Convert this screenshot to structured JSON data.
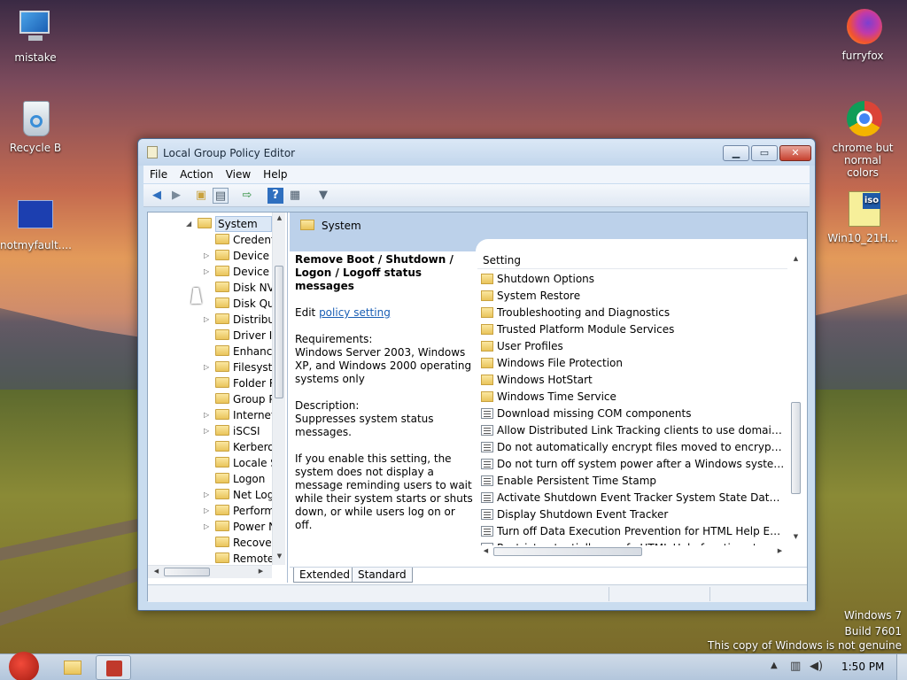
{
  "desktop": {
    "icons": [
      {
        "label": "mistake",
        "icon": "computer-icon"
      },
      {
        "label": "Recycle B",
        "icon": "recycle-bin-icon"
      },
      {
        "label": "notmyfault....",
        "icon": "bsod-icon"
      },
      {
        "label": "furryfox",
        "icon": "firefox-icon"
      },
      {
        "label": "chrome but normal colors",
        "icon": "chrome-icon"
      },
      {
        "label": "Win10_21H...",
        "icon": "iso-file-icon"
      }
    ],
    "watermark": {
      "line1": "Windows 7",
      "line2": "Build 7601",
      "line3": "This copy of Windows is not genuine"
    }
  },
  "window": {
    "title": "Local Group Policy Editor",
    "controls": {
      "minimize": "▁",
      "maximize": "▭",
      "close": "✕"
    },
    "menu": [
      "File",
      "Action",
      "View",
      "Help"
    ],
    "toolbar_icons": [
      "back-icon",
      "forward-icon",
      "up-folder-icon",
      "show-hide-tree-icon",
      "export-list-icon",
      "help-icon",
      "properties-icon",
      "filter-icon"
    ]
  },
  "tree": {
    "root": "System",
    "items": [
      {
        "label": "Credenti",
        "expandable": false
      },
      {
        "label": "Device I",
        "expandable": true
      },
      {
        "label": "Device I",
        "expandable": true
      },
      {
        "label": "Disk NV",
        "expandable": false
      },
      {
        "label": "Disk Qu",
        "expandable": false
      },
      {
        "label": "Distribu",
        "expandable": true
      },
      {
        "label": "Driver Ir",
        "expandable": false
      },
      {
        "label": "Enhanc",
        "expandable": false
      },
      {
        "label": "Filesyste",
        "expandable": true
      },
      {
        "label": "Folder R",
        "expandable": false
      },
      {
        "label": "Group P",
        "expandable": false
      },
      {
        "label": "Internet",
        "expandable": true
      },
      {
        "label": "iSCSI",
        "expandable": true
      },
      {
        "label": "Kerbero",
        "expandable": false
      },
      {
        "label": "Locale S",
        "expandable": false
      },
      {
        "label": "Logon",
        "expandable": false
      },
      {
        "label": "Net Log",
        "expandable": true
      },
      {
        "label": "Perform",
        "expandable": true
      },
      {
        "label": "Power N",
        "expandable": true
      },
      {
        "label": "Recover",
        "expandable": false
      },
      {
        "label": "Remote",
        "expandable": false
      }
    ]
  },
  "details": {
    "header": "System",
    "title": "Remove Boot / Shutdown / Logon / Logoff status messages",
    "edit_prefix": "Edit ",
    "edit_link": "policy setting",
    "requirements_label": "Requirements:",
    "requirements_text": "Windows Server 2003, Windows XP, and Windows 2000 operating systems only",
    "description_label": "Description:",
    "description_text": "Suppresses system status messages.",
    "description_more": "If you enable this setting, the system does not display a message reminding users to wait while their system starts or shuts down, or while users log on or off."
  },
  "list": {
    "column_header": "Setting",
    "rows": [
      {
        "label": "Shutdown Options",
        "type": "folder"
      },
      {
        "label": "System Restore",
        "type": "folder"
      },
      {
        "label": "Troubleshooting and Diagnostics",
        "type": "folder"
      },
      {
        "label": "Trusted Platform Module Services",
        "type": "folder"
      },
      {
        "label": "User Profiles",
        "type": "folder"
      },
      {
        "label": "Windows File Protection",
        "type": "folder"
      },
      {
        "label": "Windows HotStart",
        "type": "folder"
      },
      {
        "label": "Windows Time Service",
        "type": "folder"
      },
      {
        "label": "Download missing COM components",
        "type": "setting"
      },
      {
        "label": "Allow Distributed Link Tracking clients to use domain resour...",
        "type": "setting"
      },
      {
        "label": "Do not automatically encrypt files moved to encrypted fold...",
        "type": "setting"
      },
      {
        "label": "Do not turn off system power after a Windows system shutd...",
        "type": "setting"
      },
      {
        "label": "Enable Persistent Time Stamp",
        "type": "setting"
      },
      {
        "label": "Activate Shutdown Event Tracker System State Data feature",
        "type": "setting"
      },
      {
        "label": "Display Shutdown Event Tracker",
        "type": "setting"
      },
      {
        "label": "Turn off Data Execution Prevention for HTML Help Executible",
        "type": "setting"
      },
      {
        "label": "Restrict potentially unsafe HTML Help functions to specified...",
        "type": "setting"
      }
    ]
  },
  "tabs": [
    "Extended",
    "Standard"
  ],
  "taskbar": {
    "clock": "1:50 PM",
    "tray_icons": [
      "show-hidden-icons-icon",
      "network-icon",
      "volume-icon",
      "action-center-icon"
    ]
  }
}
